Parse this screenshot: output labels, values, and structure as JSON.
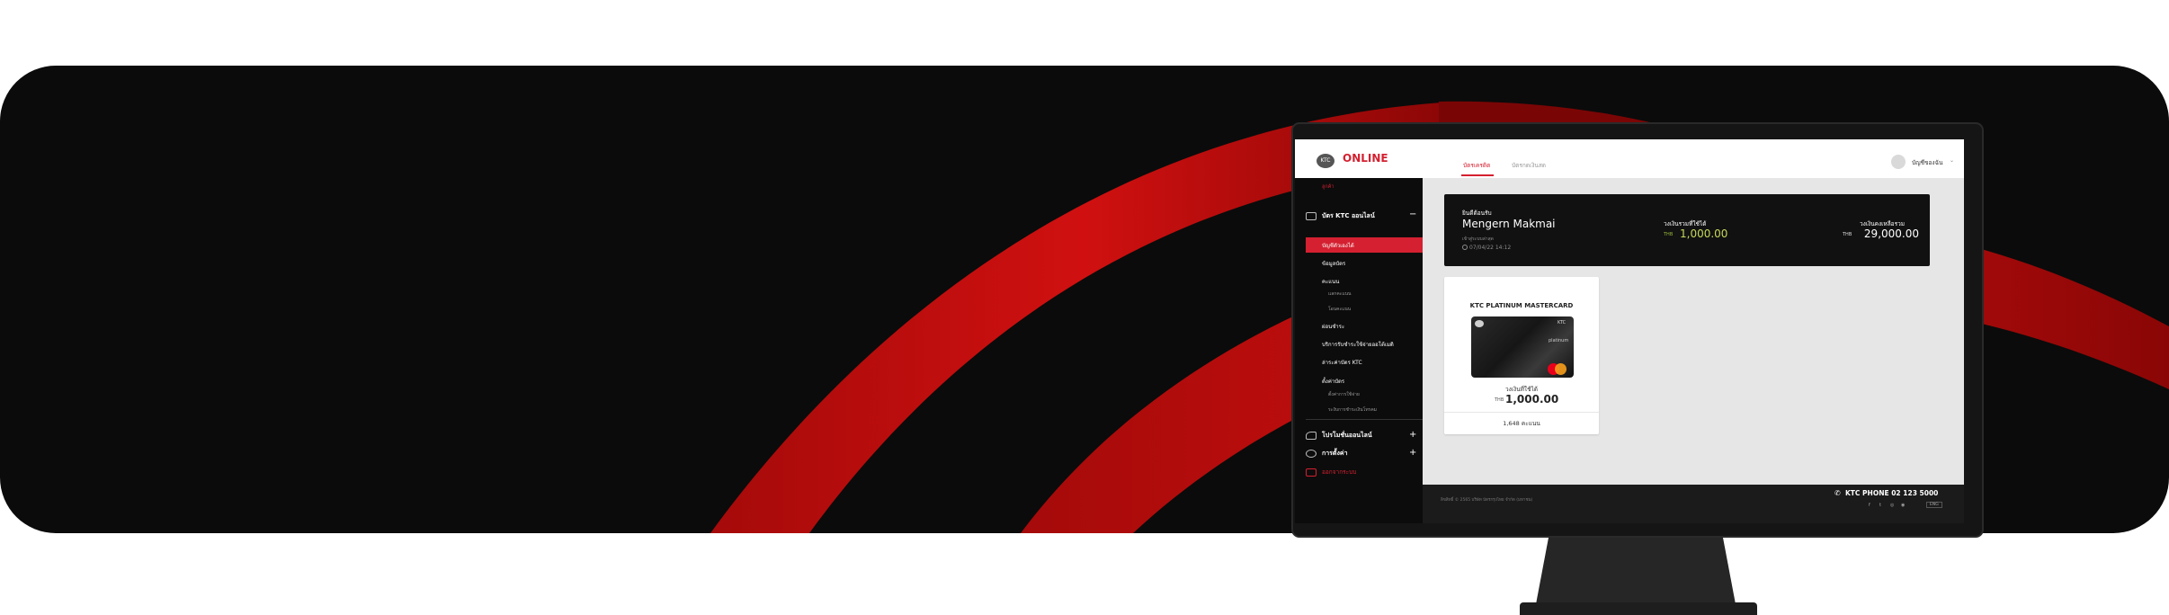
{
  "topbar": {
    "brand_badge": "KTC",
    "brand": "ONLINE",
    "tabs": [
      {
        "label": "บัตรเครดิต",
        "active": true
      },
      {
        "label": "บัตรกดเงินสด",
        "active": false
      }
    ],
    "account_label": "บัญชีของฉัน"
  },
  "sidebar": {
    "top_link": "ลูกค้า",
    "section_card": {
      "label": "บัตร KTC ออนไลน์",
      "toggle": "−"
    },
    "items": [
      {
        "label": "บัญชีตัวเองได้",
        "active": true
      },
      {
        "label": "ข้อมูลบัตร",
        "active": false
      },
      {
        "label": "คะแนน",
        "active": false
      }
    ],
    "sub_points": [
      "แลกคะแนน",
      "โอนคะแนน"
    ],
    "items2": [
      "ผ่อนชำระ",
      "บริการรับชำระใช้จ่ายออโต้เมติ",
      "ล่าระค่าบัตร KTC",
      "ตั้งค่าบัตร"
    ],
    "sub_settings": [
      "ตั้งค่าการใช้จ่าย",
      "ระงับการชำระเงินโทรคม"
    ],
    "section_promo": {
      "label": "โปรโมชั่นออนไลน์",
      "toggle": "+"
    },
    "section_settings": {
      "label": "การตั้งค่า",
      "toggle": "+"
    },
    "logout": "ออกจากระบบ"
  },
  "banner": {
    "greeting": "ยินดีต้อนรับ",
    "name": "Mengern Makmai",
    "last_login_label": "เข้าสู่ระบบล่าสุด",
    "last_login_time": "07/04/22 14:12",
    "credit_limit_label": "วงเงินรวมที่ใช้ได้",
    "currency": "THB",
    "credit_limit_value": "1,000.00",
    "available_label": "วงเงินคงเหลือรวม",
    "available_value": "29,000.00"
  },
  "card": {
    "title": "KTC PLATINUM MASTERCARD",
    "image_ktc": "KTC",
    "image_platinum": "platinum",
    "available_label": "วงเงินที่ใช้ได้",
    "currency": "THB",
    "available_value": "1,000.00",
    "points": "1,648 คะแนน"
  },
  "footer": {
    "copyright": "ลิขสิทธิ์ © 2565 บริษัท บัตรกรุงไทย จำกัด (มหาชน)",
    "phone": "KTC PHONE 02 123 5000",
    "social_icons": [
      "facebook-icon",
      "twitter-icon",
      "instagram-icon",
      "line-icon"
    ],
    "social_glyphs": [
      "f",
      "t",
      "◎",
      "◉"
    ],
    "lang": "ENG"
  },
  "colors": {
    "accent": "#d42030",
    "limit": "#c7d95a",
    "hero_bg": "#0b0b0b"
  }
}
